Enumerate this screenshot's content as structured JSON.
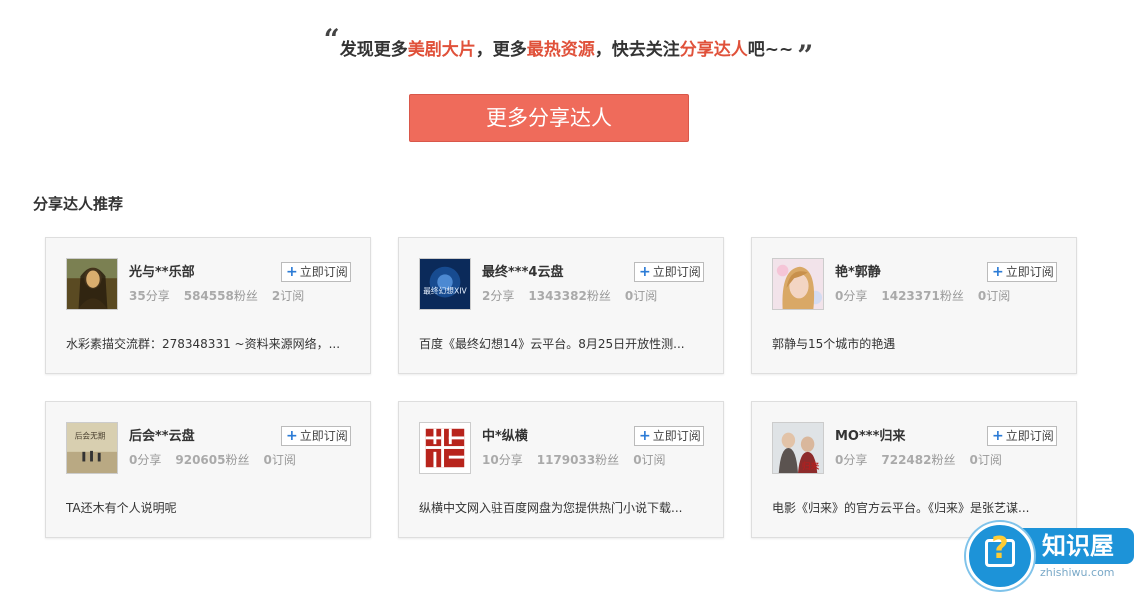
{
  "headline": {
    "quote_open": "“",
    "p1": "发现更多",
    "h1": "美剧大片",
    "p2": "，更多",
    "h2": "最热资源",
    "p3": "，快去关注",
    "h3": "分享达人",
    "p4": "吧~~",
    "quote_close": "”"
  },
  "more_button": "更多分享达人",
  "section_title": "分享达人推荐",
  "subscribe_label": "立即订阅",
  "units": {
    "share": "分享",
    "fans": "粉丝",
    "sub": "订阅"
  },
  "cards": [
    {
      "name": "光与**乐部",
      "shares": "35",
      "fans": "584558",
      "subs": "2",
      "desc": "水彩素描交流群：278348331 ~资料来源网络，...",
      "avatar": "mona-lisa-avatar"
    },
    {
      "name": "最终***4云盘",
      "shares": "2",
      "fans": "1343382",
      "subs": "0",
      "desc": "百度《最终幻想14》云平台。8月25日开放性测...",
      "avatar": "final-fantasy-avatar",
      "avatar_text": "最终幻想XIV"
    },
    {
      "name": "艳*郭静",
      "shares": "0",
      "fans": "1423371",
      "subs": "0",
      "desc": "郭静与15个城市的艳遇",
      "avatar": "portrait-avatar"
    },
    {
      "name": "后会**云盘",
      "shares": "0",
      "fans": "920605",
      "subs": "0",
      "desc": "TA还木有个人说明呢",
      "avatar": "movie-poster-avatar",
      "avatar_text": "后会无期"
    },
    {
      "name": "中*纵横",
      "shares": "10",
      "fans": "1179033",
      "subs": "0",
      "desc": "纵横中文网入驻百度网盘为您提供热门小说下载...",
      "avatar": "zongheng-logo-avatar"
    },
    {
      "name": "MO***归来",
      "shares": "0",
      "fans": "722482",
      "subs": "0",
      "desc": "电影《归来》的官方云平台。《归来》是张艺谋...",
      "avatar": "guilai-poster-avatar",
      "avatar_text": "归来"
    }
  ],
  "watermark": {
    "name": "知识屋",
    "domain": "zhishiwu.com"
  },
  "colors": {
    "accent": "#ef6b5b",
    "highlight": "#e0513a",
    "plus": "#2b7bd6"
  }
}
